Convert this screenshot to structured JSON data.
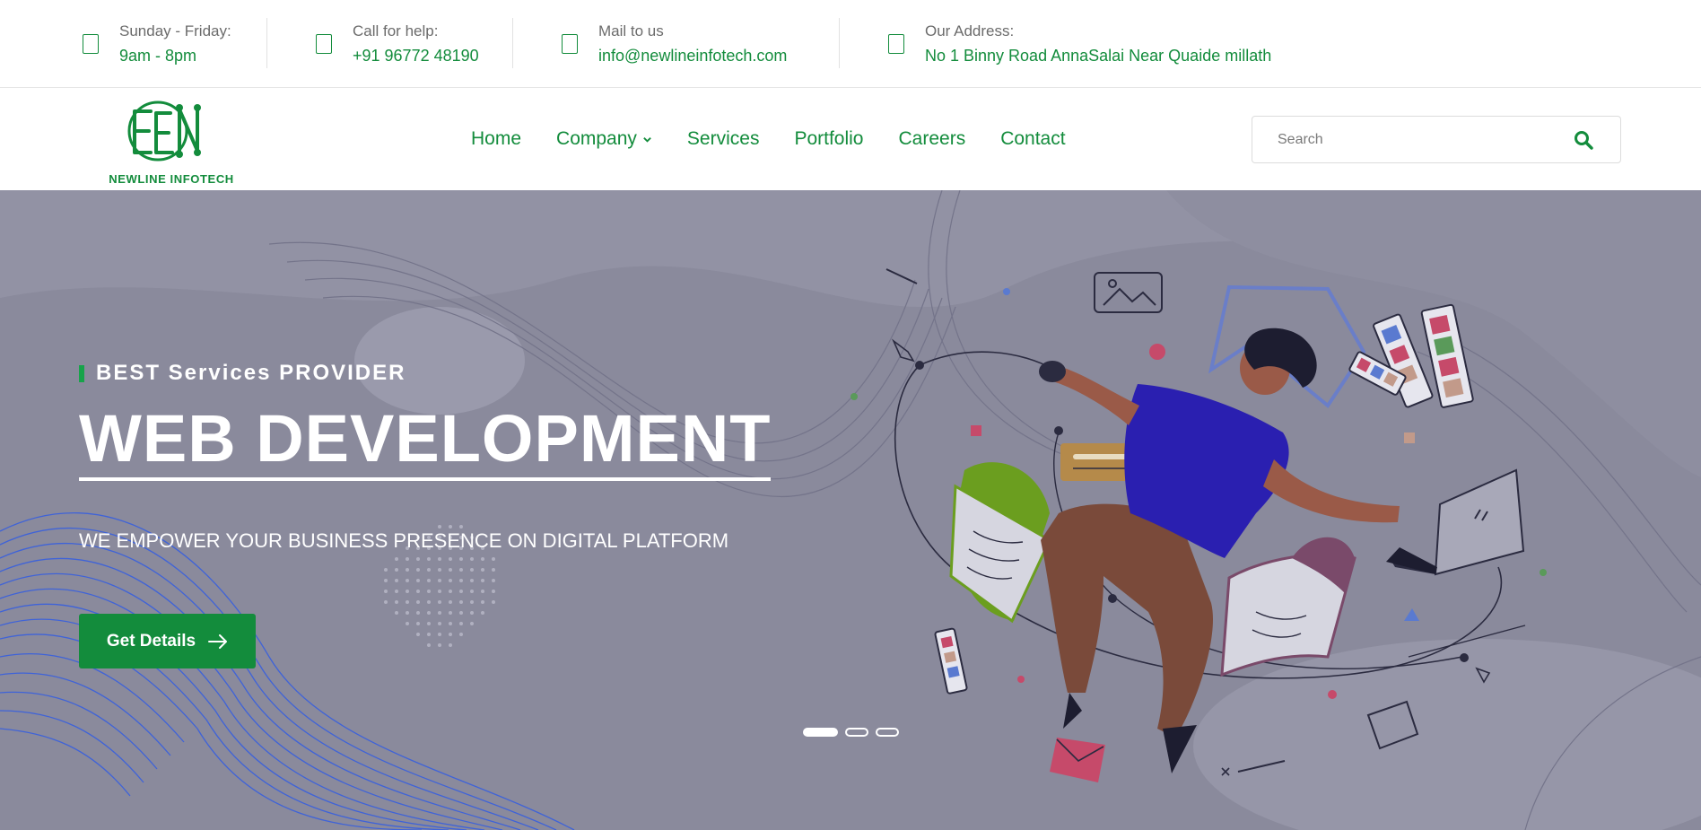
{
  "topbar": {
    "hours": {
      "label": "Sunday - Friday:",
      "value": "9am - 8pm",
      "icon": "clock-icon"
    },
    "phone": {
      "label": "Call for help:",
      "value": "+91 96772 48190",
      "icon": "phone-icon"
    },
    "email": {
      "label": "Mail to us",
      "value": "info@newlineinfotech.com",
      "icon": "mail-icon"
    },
    "address": {
      "label": "Our Address:",
      "value": "No 1 Binny Road AnnaSalai Near Quaide millath",
      "icon": "location-icon"
    }
  },
  "brand": {
    "name": "NEWLINE INFOTECH",
    "color": "#138c3c"
  },
  "nav": {
    "items": [
      "Home",
      "Company",
      "Services",
      "Portfolio",
      "Careers",
      "Contact"
    ],
    "dropdown_item": "Company"
  },
  "search": {
    "placeholder": "Search",
    "value": ""
  },
  "hero": {
    "tagline": "BEST Services PROVIDER",
    "headline": "WEB DEVELOPMENT",
    "subline": "WE EMPOWER YOUR BUSINESS PRESENCE ON DIGITAL PLATFORM",
    "cta_label": "Get Details",
    "slides": {
      "count": 3,
      "active": 1
    }
  },
  "colors": {
    "accent": "#138c3c",
    "overlay": "#8a8a9c",
    "wave": "#3f63d8"
  }
}
